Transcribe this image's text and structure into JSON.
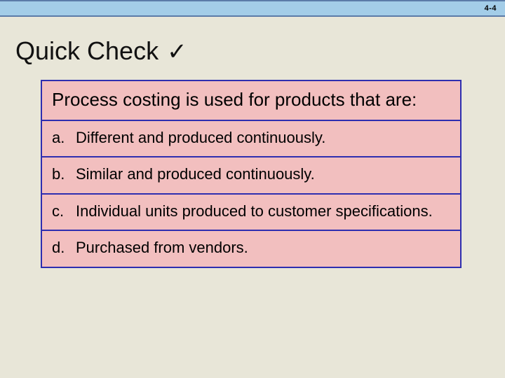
{
  "header": {
    "slide_number": "4-4"
  },
  "title": {
    "text": "Quick Check",
    "check_symbol": "✓"
  },
  "question": "Process costing is used for products that are:",
  "options": [
    {
      "letter": "a.",
      "text": "Different and produced continuously."
    },
    {
      "letter": "b.",
      "text": "Similar and produced continuously."
    },
    {
      "letter": "c.",
      "text": "Individual units produced to customer specifications."
    },
    {
      "letter": "d.",
      "text": "Purchased from vendors."
    }
  ]
}
